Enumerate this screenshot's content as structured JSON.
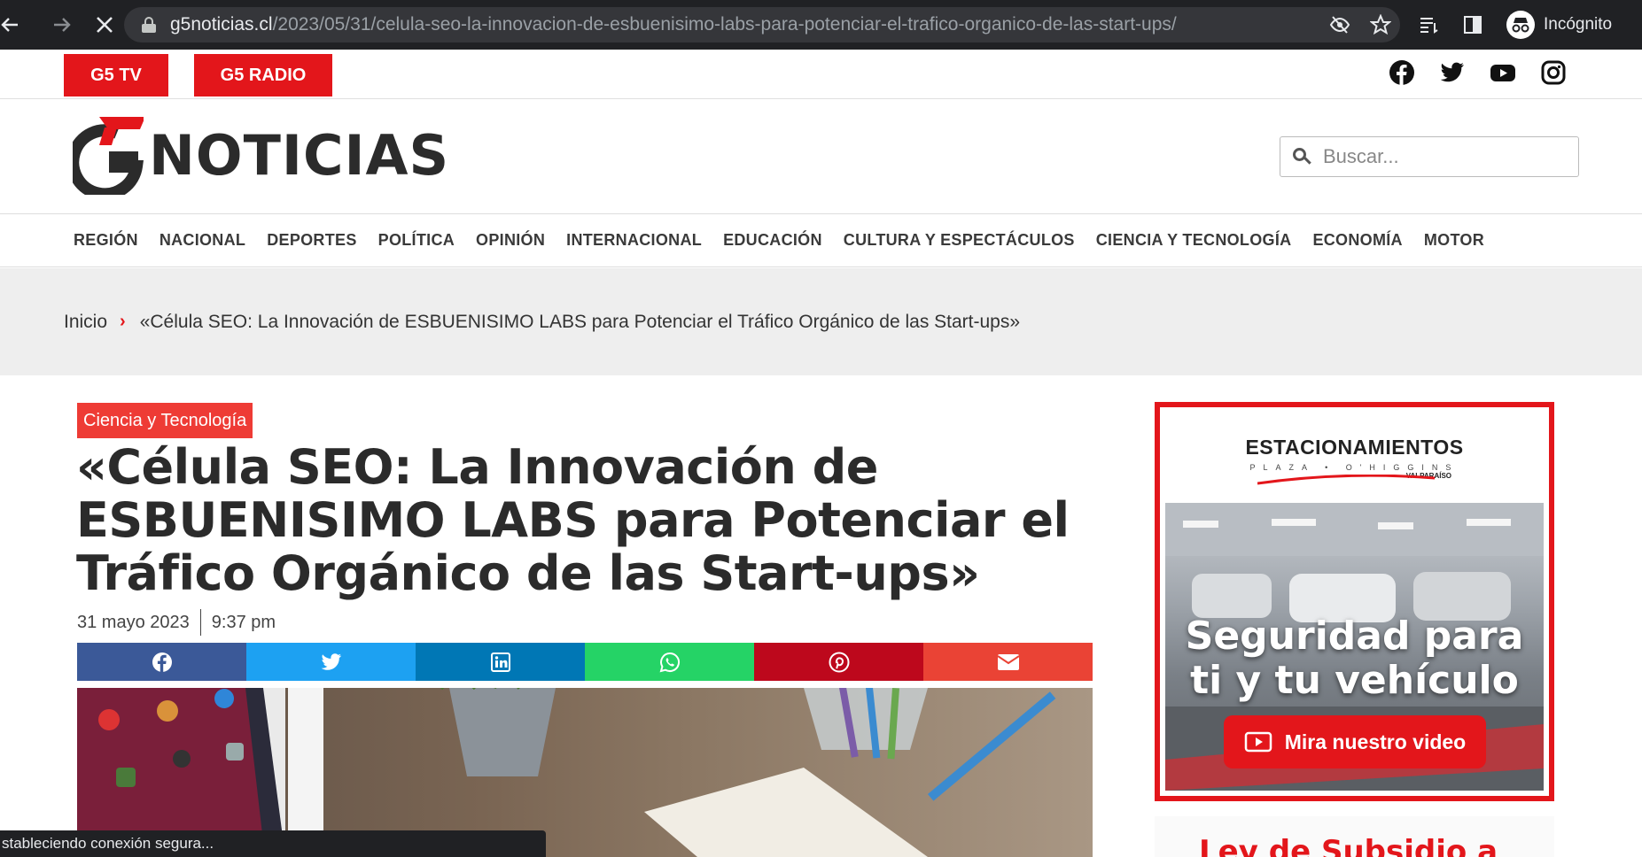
{
  "browser": {
    "url_host": "g5noticias.cl",
    "url_path": "/2023/05/31/celula-seo-la-innovacion-de-esbuenisimo-labs-para-potenciar-el-trafico-organico-de-las-start-ups/",
    "profile_label": "Incógnito",
    "status_text": "stableciendo conexión segura..."
  },
  "topbar": {
    "g5tv_label": "G5 TV",
    "g5radio_label": "G5 RADIO",
    "social_icons": [
      "facebook-icon",
      "twitter-icon",
      "youtube-icon",
      "instagram-icon"
    ]
  },
  "header": {
    "logo_text": "NOTICIAS",
    "logo_mark": "G5",
    "search_placeholder": "Buscar..."
  },
  "nav": {
    "items": [
      "REGIÓN",
      "NACIONAL",
      "DEPORTES",
      "POLÍTICA",
      "OPINIÓN",
      "INTERNACIONAL",
      "EDUCACIÓN",
      "CULTURA Y ESPECTÁCULOS",
      "CIENCIA Y TECNOLOGÍA",
      "ECONOMÍA",
      "MOTOR"
    ]
  },
  "breadcrumb": {
    "home": "Inicio",
    "current": "«Célula SEO: La Innovación de ESBUENISIMO LABS para Potenciar el Tráfico Orgánico de las Start-ups»"
  },
  "article": {
    "category": "Ciencia y Tecnología",
    "title": "«Célula SEO: La Innovación de ESBUENISIMO LABS para Potenciar el Tráfico Orgánico de las Start-ups»",
    "date": "31 mayo 2023",
    "time": "9:37 pm",
    "share_buttons": [
      {
        "name": "facebook-share-button",
        "icon": "facebook-icon",
        "color": "#3b5998"
      },
      {
        "name": "twitter-share-button",
        "icon": "twitter-icon",
        "color": "#1da1f2"
      },
      {
        "name": "linkedin-share-button",
        "icon": "linkedin-icon",
        "color": "#0077b5"
      },
      {
        "name": "whatsapp-share-button",
        "icon": "whatsapp-icon",
        "color": "#25d366"
      },
      {
        "name": "pinterest-share-button",
        "icon": "pinterest-icon",
        "color": "#bd081c"
      },
      {
        "name": "email-share-button",
        "icon": "envelope-icon",
        "color": "#ea4335"
      }
    ]
  },
  "sidebar": {
    "ad_brand": "ESTACIONAMIENTOS",
    "ad_subbrand": "PLAZA • O'HIGGINS",
    "ad_city": "VALPARAÍSO",
    "ad_headline_1": "Seguridad para",
    "ad_headline_2": "ti y tu vehículo",
    "ad_button": "Mira nuestro video",
    "ad2_text": "Ley de Subsidio a"
  },
  "colors": {
    "accent_red": "#e3161b",
    "chrome_bg": "#202124"
  }
}
